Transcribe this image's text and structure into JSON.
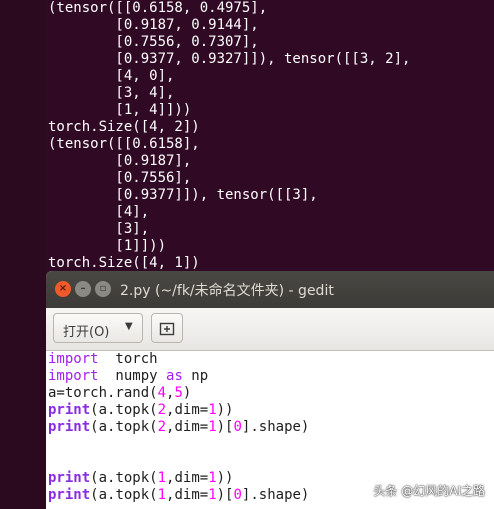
{
  "terminal": {
    "lines": [
      "(tensor([[0.6158, 0.4975],",
      "        [0.9187, 0.9144],",
      "        [0.7556, 0.7307],",
      "        [0.9377, 0.9327]]), tensor([[3, 2],",
      "        [4, 0],",
      "        [3, 4],",
      "        [1, 4]]))",
      "torch.Size([4, 2])",
      "(tensor([[0.6158],",
      "        [0.9187],",
      "        [0.7556],",
      "        [0.9377]]), tensor([[3],",
      "        [4],",
      "        [3],",
      "        [1]]))",
      "torch.Size([4, 1])"
    ]
  },
  "gedit": {
    "title": "2.py (~/fk/未命名文件夹) - gedit",
    "open_label": "打开(O)",
    "code": [
      {
        "parts": [
          [
            "kw",
            "import"
          ],
          [
            "",
            "  torch"
          ]
        ]
      },
      {
        "parts": [
          [
            "kw",
            "import"
          ],
          [
            "",
            "  numpy "
          ],
          [
            "kw",
            "as"
          ],
          [
            "",
            " np"
          ]
        ]
      },
      {
        "parts": [
          [
            "",
            "a=torch.rand("
          ],
          [
            "",
            "4"
          ],
          [
            "",
            ","
          ],
          [
            "",
            "5"
          ],
          [
            "",
            ")"
          ]
        ]
      },
      {
        "parts": [
          [
            "fn",
            "print"
          ],
          [
            "",
            "(a.topk("
          ],
          [
            "",
            "2"
          ],
          [
            "",
            ",dim="
          ],
          [
            "",
            "1"
          ],
          [
            "",
            "))"
          ]
        ]
      },
      {
        "parts": [
          [
            "fn",
            "print"
          ],
          [
            "",
            "(a.topk("
          ],
          [
            "",
            "2"
          ],
          [
            "",
            ",dim="
          ],
          [
            "",
            "1"
          ],
          [
            "",
            ")["
          ],
          [
            "",
            "0"
          ],
          [
            "",
            "].shape)"
          ]
        ]
      },
      {
        "parts": [
          [
            "",
            ""
          ]
        ]
      },
      {
        "parts": [
          [
            "",
            ""
          ]
        ]
      },
      {
        "parts": [
          [
            "fn",
            "print"
          ],
          [
            "",
            "(a.topk("
          ],
          [
            "",
            "1"
          ],
          [
            "",
            ",dim="
          ],
          [
            "",
            "1"
          ],
          [
            "",
            "))"
          ]
        ]
      },
      {
        "parts": [
          [
            "fn",
            "print"
          ],
          [
            "",
            "(a.topk("
          ],
          [
            "",
            "1"
          ],
          [
            "",
            ",dim="
          ],
          [
            "",
            "1"
          ],
          [
            "",
            ")["
          ],
          [
            "",
            "0"
          ],
          [
            "",
            "].shape)"
          ]
        ]
      }
    ]
  },
  "watermark": "头条 @幻风的AI之路"
}
